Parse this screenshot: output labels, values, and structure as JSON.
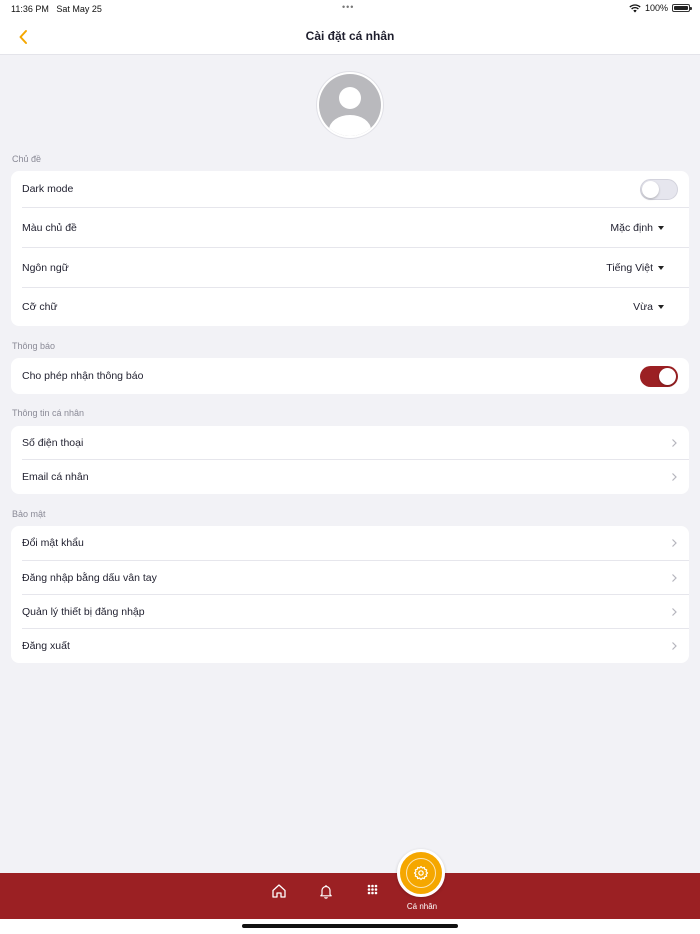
{
  "status_bar": {
    "time": "11:36 PM",
    "date": "Sat May 25",
    "battery": "100%"
  },
  "header": {
    "title": "Cài đặt cá nhân",
    "back_icon": "chevron-left-icon"
  },
  "sections": {
    "theme": {
      "label": "Chủ đề",
      "dark_mode": {
        "label": "Dark mode",
        "enabled": false
      },
      "theme_color": {
        "label": "Màu chủ đề",
        "value": "Mặc định"
      },
      "language": {
        "label": "Ngôn ngữ",
        "value": "Tiếng Việt"
      },
      "font_size": {
        "label": "Cỡ chữ",
        "value": "Vừa"
      }
    },
    "notifications": {
      "label": "Thông báo",
      "allow": {
        "label": "Cho phép nhận thông báo",
        "enabled": true
      }
    },
    "personal": {
      "label": "Thông tin cá nhân",
      "phone": {
        "label": "Số điện thoại"
      },
      "email": {
        "label": "Email cá nhân"
      }
    },
    "security": {
      "label": "Bảo mật",
      "change_password": {
        "label": "Đổi mật khẩu"
      },
      "fingerprint_login": {
        "label": "Đăng nhập bằng dấu vân tay"
      },
      "manage_devices": {
        "label": "Quản lý thiết bị đăng nhập"
      },
      "logout": {
        "label": "Đăng xuất"
      }
    }
  },
  "tabbar": {
    "items": [
      "home-icon",
      "bell-icon",
      "grid-icon",
      "gear-icon"
    ],
    "active_label": "Cá nhân"
  },
  "colors": {
    "brand": "#9b2023",
    "accent": "#f5a700",
    "background": "#f2f2f6"
  }
}
